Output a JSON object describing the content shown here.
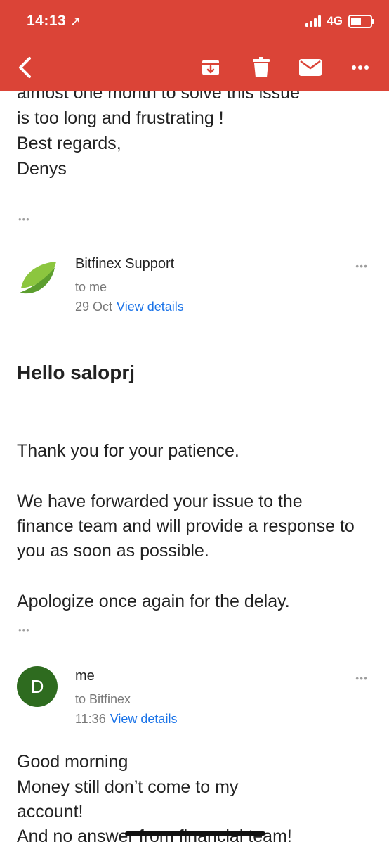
{
  "status_bar": {
    "time": "14:13",
    "network": "4G"
  },
  "toolbar": {
    "back_icon": "chevron-left-icon",
    "actions": [
      "archive-icon",
      "trash-icon",
      "mail-icon",
      "more-icon"
    ]
  },
  "previous_message": {
    "lines": [
      "almost one month to solve this issue",
      "is too long and frustrating !",
      "Best regards,",
      "Denys"
    ],
    "collapsed_indicator": "•••"
  },
  "message_1": {
    "sender": "Bitfinex Support",
    "recipient": "to me",
    "date": "29 Oct",
    "view_details": "View details",
    "greeting": "Hello saloprj",
    "paragraphs": [
      "Thank you for your patience.",
      "We have forwarded your issue to the finance team and will provide a response to you as soon as possible.",
      "Apologize once again for the delay."
    ],
    "collapsed_indicator": "•••"
  },
  "message_2": {
    "avatar_letter": "D",
    "sender": "me",
    "recipient": "to Bitfinex",
    "time": "11:36",
    "view_details": "View details",
    "lines": [
      "Good morning",
      "Money still don’t come to my",
      "account!",
      "And no answer from financial team!"
    ]
  },
  "colors": {
    "header": "#db4437",
    "link": "#1a73e8",
    "avatar_bg": "#2e6b1f"
  }
}
